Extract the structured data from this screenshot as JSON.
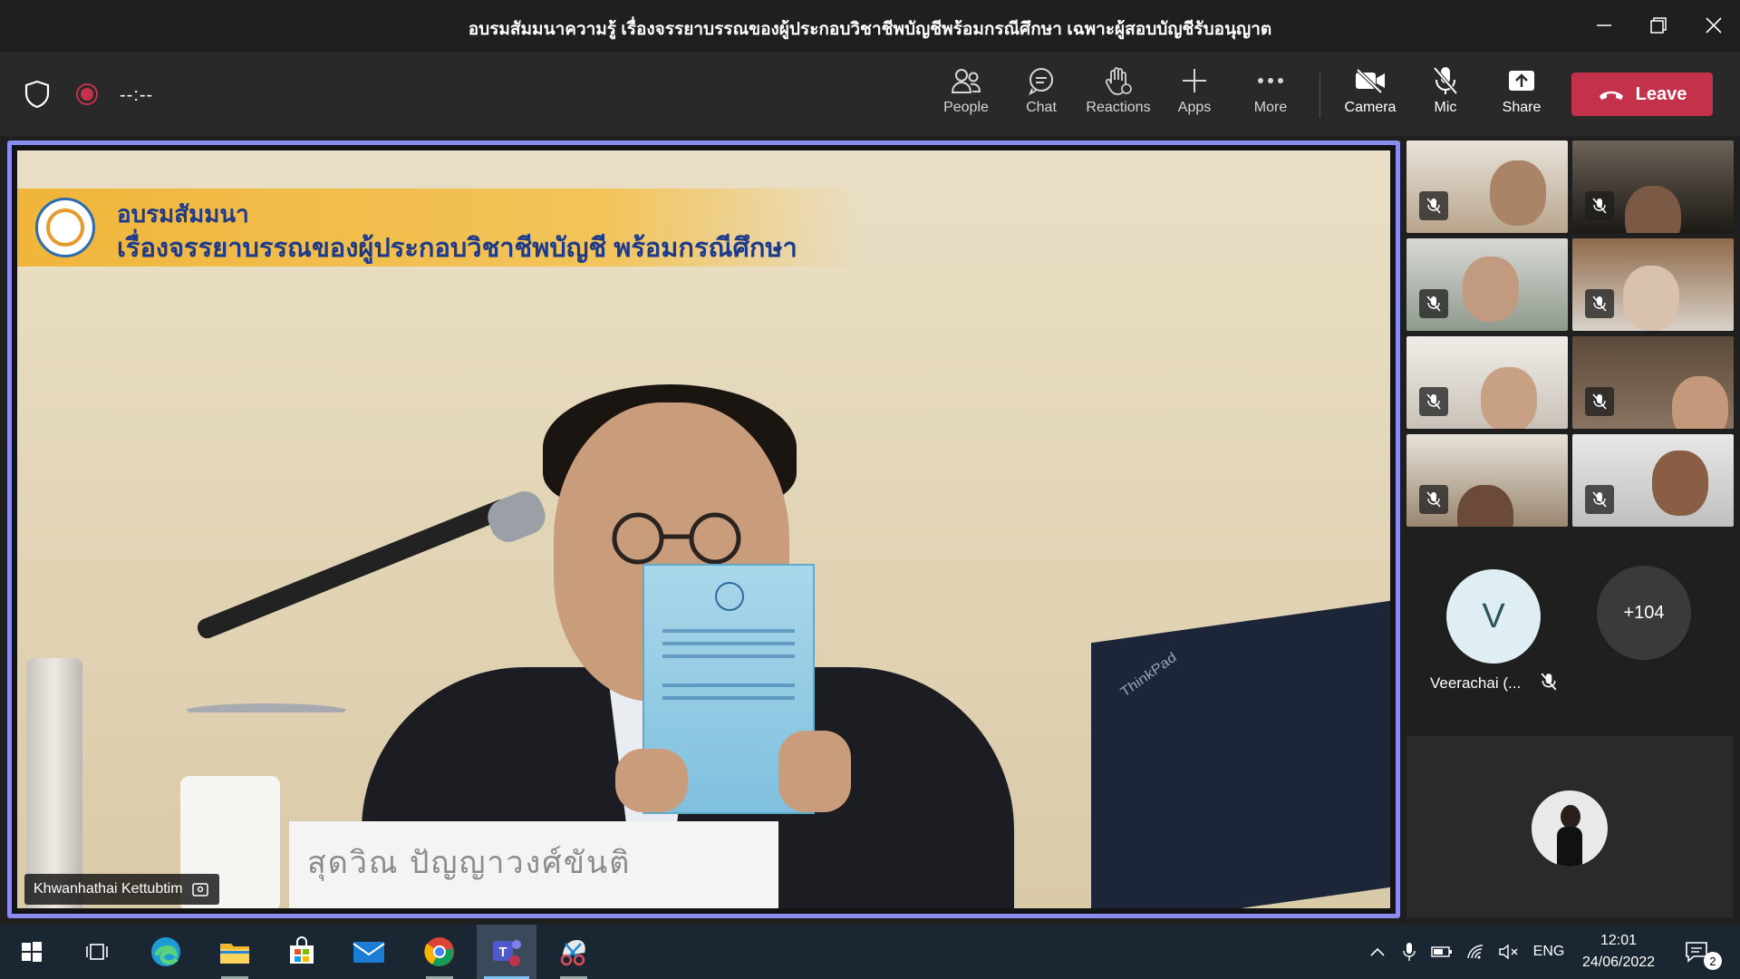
{
  "window": {
    "title": "อบรมสัมมนาความรู้ เรื่องจรรยาบรรณของผู้ประกอบวิชาชีพบัญชีพร้อมกรณีศึกษา เฉพาะผู้สอบบัญชีรับอนุญาต"
  },
  "meeting_bar": {
    "timer": "--:--",
    "tools": [
      {
        "id": "people",
        "label": "People",
        "icon": "people-icon"
      },
      {
        "id": "chat",
        "label": "Chat",
        "icon": "chat-icon"
      },
      {
        "id": "reactions",
        "label": "Reactions",
        "icon": "raise-hand-icon"
      },
      {
        "id": "apps",
        "label": "Apps",
        "icon": "plus-icon"
      },
      {
        "id": "more",
        "label": "More",
        "icon": "ellipsis-icon"
      },
      {
        "id": "camera",
        "label": "Camera",
        "icon": "camera-off-icon"
      },
      {
        "id": "mic",
        "label": "Mic",
        "icon": "mic-off-icon"
      },
      {
        "id": "share",
        "label": "Share",
        "icon": "share-icon"
      }
    ],
    "leave_label": "Leave"
  },
  "stage": {
    "banner_line1": "อบรมสัมมนา",
    "banner_line2": "เรื่องจรรยาบรรณของผู้ประกอบวิชาชีพบัญชี พร้อมกรณีศึกษา",
    "nameplate_text": "สุดวิณ   ปัญญาวงศ์ขันติ",
    "laptop_brand": "ThinkPad",
    "speaker_name": "Khwanhathai Kettubtim"
  },
  "participants": {
    "tiles_muted": 8,
    "avatar_initial": "V",
    "avatar_name": "Veerachai (...",
    "overflow_count": "+104"
  },
  "taskbar": {
    "apps": [
      "windows-start-icon",
      "task-view-icon",
      "edge-icon",
      "file-explorer-icon",
      "store-icon",
      "mail-icon",
      "chrome-icon",
      "teams-icon",
      "snip-icon"
    ],
    "language": "ENG",
    "time": "12:01",
    "date": "24/06/2022",
    "notification_count": "2"
  },
  "colors": {
    "leave": "#c4314b",
    "stage_border": "#8b8cf0",
    "toolbar": "#292929",
    "taskbar": "#1a2733"
  }
}
